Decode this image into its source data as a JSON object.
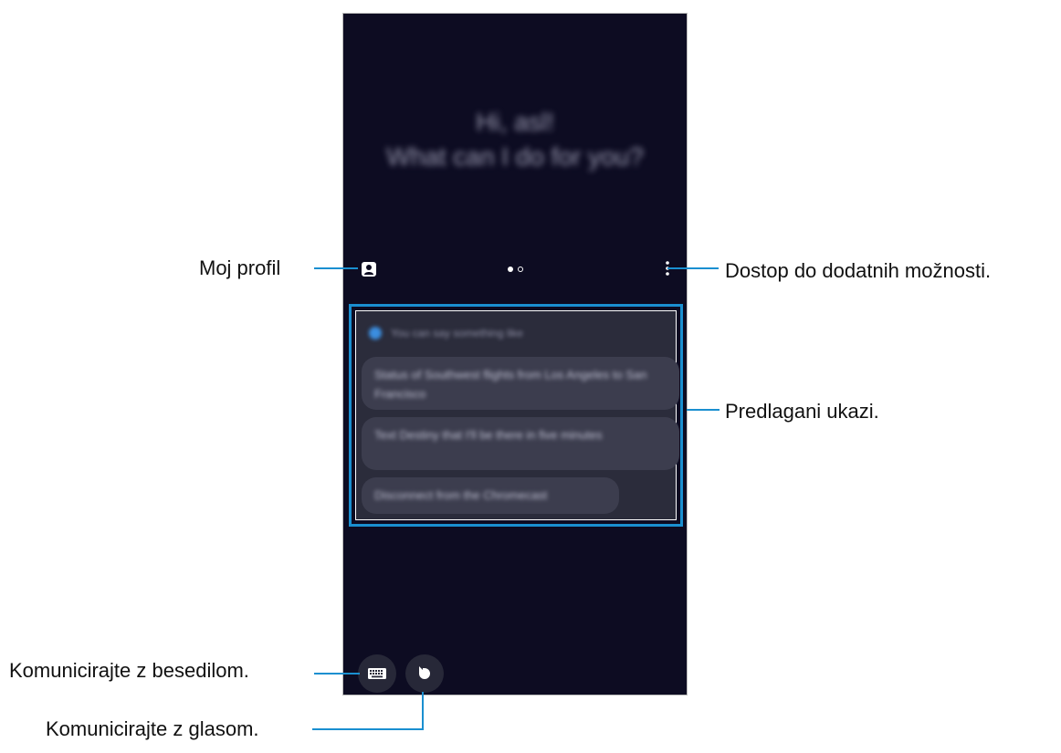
{
  "screen": {
    "greeting_line1": "Hi, asl!",
    "greeting_line2": "What can I do for you?",
    "hint": "You can say something like",
    "suggestions": [
      "Status of Southwest flights from Los Angeles to San Francisco",
      "Text Destiny that I'll be there in five minutes",
      "Disconnect from the Chromecast"
    ]
  },
  "callouts": {
    "profile": "Moj profil",
    "more": "Dostop do dodatnih možnosti.",
    "suggested": "Predlagani ukazi.",
    "text": "Komunicirajte z besedilom.",
    "voice": "Komunicirajte z glasom."
  },
  "icons": {
    "profile": "person-icon",
    "more": "more-vertical-icon",
    "keyboard": "keyboard-icon",
    "voice": "bixby-voice-icon"
  },
  "colors": {
    "callout_line": "#1a8fd0",
    "screen_bg": "#0d0c22"
  }
}
